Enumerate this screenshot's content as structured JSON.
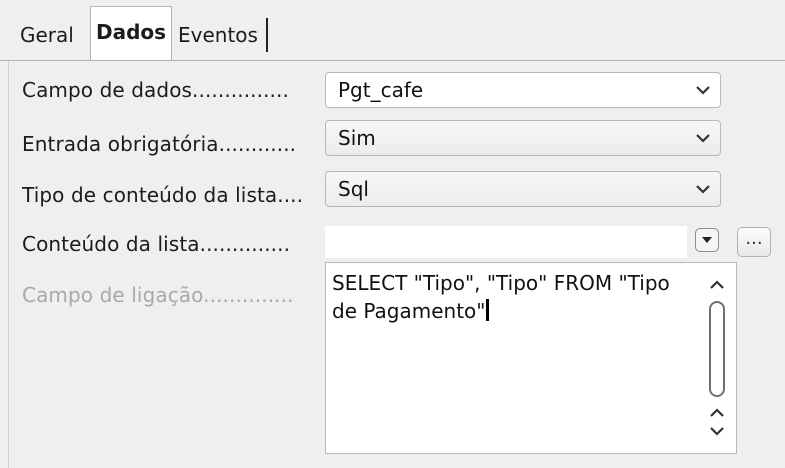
{
  "tabs": [
    {
      "label": "Geral"
    },
    {
      "label": "Dados"
    },
    {
      "label": "Eventos"
    }
  ],
  "fields": {
    "data_field": {
      "label": "Campo de dados...............",
      "value": "Pgt_cafe"
    },
    "input_required": {
      "label": "Entrada obrigatória............",
      "value": "Sim"
    },
    "list_content_type": {
      "label": "Tipo de conteúdo da lista....",
      "value": "Sql"
    },
    "list_content": {
      "label": "Conteúdo da lista..............",
      "value": "",
      "browse_label": "..."
    },
    "bound_field": {
      "label": "Campo de ligação.............."
    }
  },
  "sql_editor": {
    "text": "SELECT \"Tipo\", \"Tipo\" FROM \"Tipo de Pagamento\""
  },
  "icons": {
    "chevron": "chevron-down-icon",
    "dropdown_small": "dropdown-arrow-icon",
    "scroll_up": "chevron-up-icon",
    "scroll_down": "chevron-down-icon"
  },
  "colors": {
    "panel_bg": "#efefef",
    "disabled_text": "#a9a9a9"
  }
}
